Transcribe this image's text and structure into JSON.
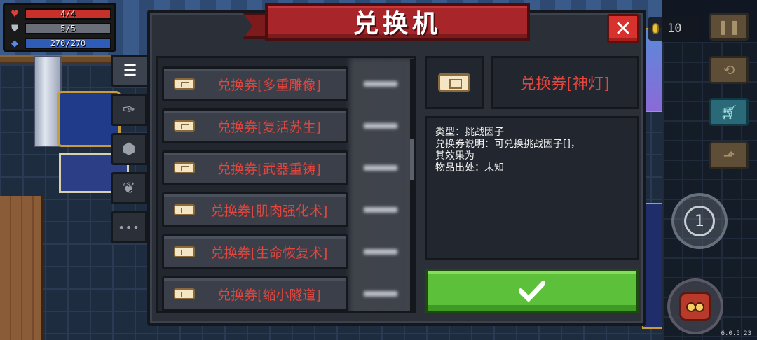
{
  "dialog": {
    "title": "兑换机",
    "close_icon": "close-icon",
    "tabs": [
      {
        "name": "list-icon",
        "glyph": "☰",
        "active": true
      },
      {
        "name": "weapon-icon",
        "glyph": "✑",
        "active": false
      },
      {
        "name": "relic-icon",
        "glyph": "⬢",
        "active": false
      },
      {
        "name": "plant-icon",
        "glyph": "❦",
        "active": false
      },
      {
        "name": "more-icon",
        "glyph": "•••",
        "active": false
      }
    ],
    "items": [
      {
        "label": "兑换券[多重雕像]"
      },
      {
        "label": "兑换券[复活苏生]"
      },
      {
        "label": "兑换券[武器重铸]"
      },
      {
        "label": "兑换券[肌肉强化术]"
      },
      {
        "label": "兑换券[生命恢复术]"
      },
      {
        "label": "兑换券[缩小隧道]"
      }
    ],
    "detail": {
      "name": "兑换券[神灯]",
      "description_lines": [
        "类型：挑战因子",
        "兑换券说明：可兑换挑战因子[]，",
        "其效果为",
        "物品出处：未知"
      ],
      "confirm_icon": "checkmark-icon"
    }
  },
  "hud": {
    "hp": {
      "text": "4/4",
      "fraction": 1.0,
      "color": "#c8302c"
    },
    "armor": {
      "text": "5/5",
      "fraction": 1.0,
      "color": "#6a6e78"
    },
    "energy": {
      "text": "270/270",
      "fraction": 1.0,
      "color": "#2e5cb8"
    },
    "coins": "10",
    "skill_level": "1"
  },
  "version": "6.0.5.23",
  "colors": {
    "item_text": "#e2463e",
    "ribbon": "#a8262a",
    "confirm": "#5cc03a"
  }
}
